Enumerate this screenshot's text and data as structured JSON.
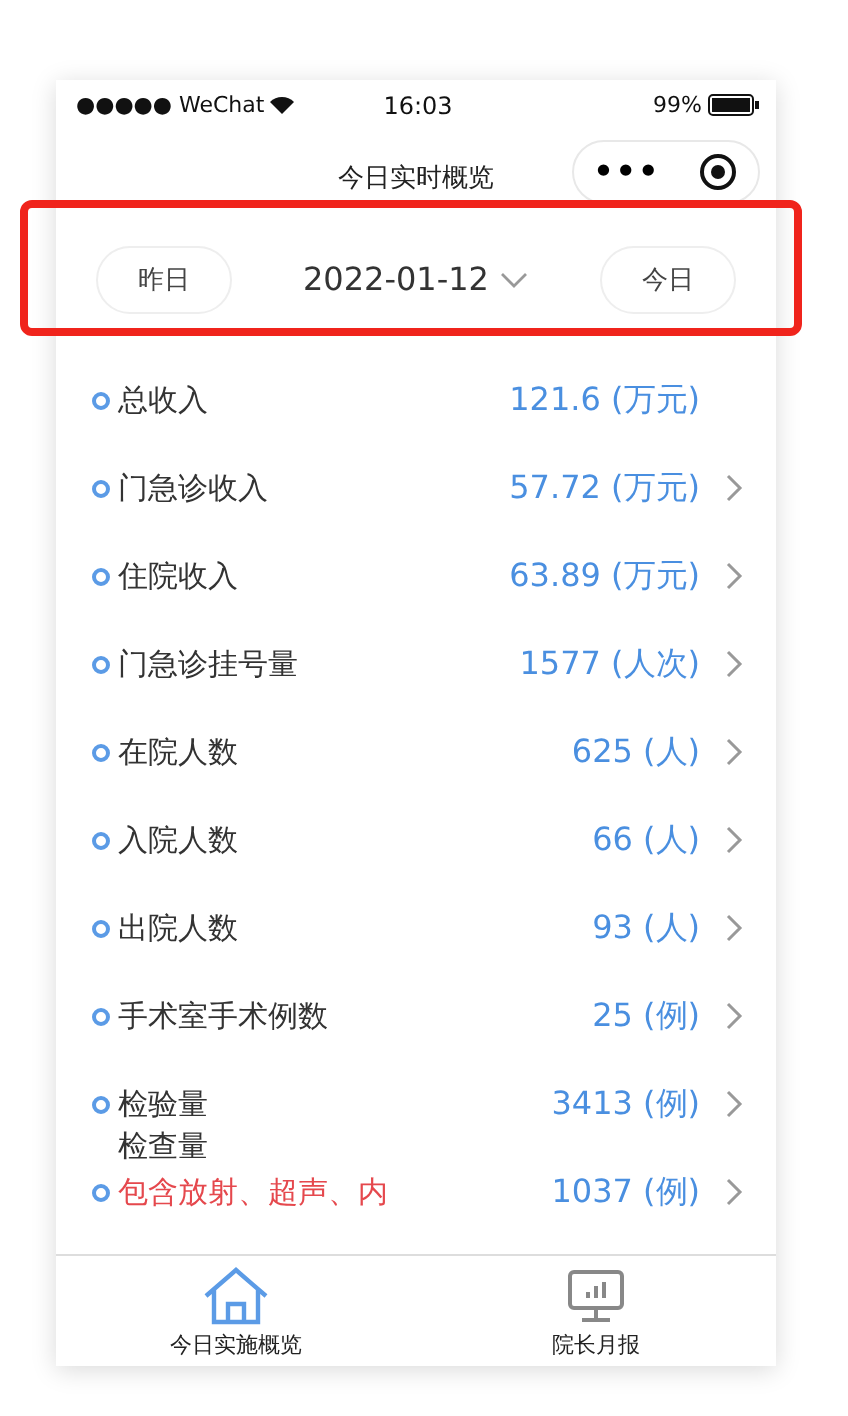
{
  "status_bar": {
    "carrier": "●●●●● WeChat",
    "time": "16:03",
    "battery": "99%"
  },
  "nav": {
    "title": "今日实时概览",
    "menu": "•••"
  },
  "date_bar": {
    "prev": "昨日",
    "date": "2022-01-12",
    "next": "今日"
  },
  "rows": [
    {
      "kind": "metric",
      "label": "总收入",
      "value": "121.6 (万元)",
      "arrow": false
    },
    {
      "kind": "metric",
      "label": "门急诊收入",
      "value": "57.72 (万元)",
      "arrow": true
    },
    {
      "kind": "metric",
      "label": "住院收入",
      "value": "63.89 (万元)",
      "arrow": true
    },
    {
      "kind": "metric",
      "label": "门急诊挂号量",
      "value": "1577 (人次)",
      "arrow": true
    },
    {
      "kind": "metric",
      "label": "在院人数",
      "value": "625 (人)",
      "arrow": true
    },
    {
      "kind": "metric",
      "label": "入院人数",
      "value": "66 (人)",
      "arrow": true
    },
    {
      "kind": "metric",
      "label": "出院人数",
      "value": "93 (人)",
      "arrow": true
    },
    {
      "kind": "metric",
      "label": "手术室手术例数",
      "value": "25 (例)",
      "arrow": true
    },
    {
      "kind": "metric",
      "label": "检验量",
      "sublabel": "检查量",
      "value": "3413 (例)",
      "arrow": true
    },
    {
      "kind": "note",
      "label": "包含放射、超声、内",
      "value": "1037 (例)",
      "arrow": true
    }
  ],
  "tabs": [
    {
      "label": "今日实施概览",
      "selected": true
    },
    {
      "label": "院长月报",
      "selected": false
    }
  ]
}
